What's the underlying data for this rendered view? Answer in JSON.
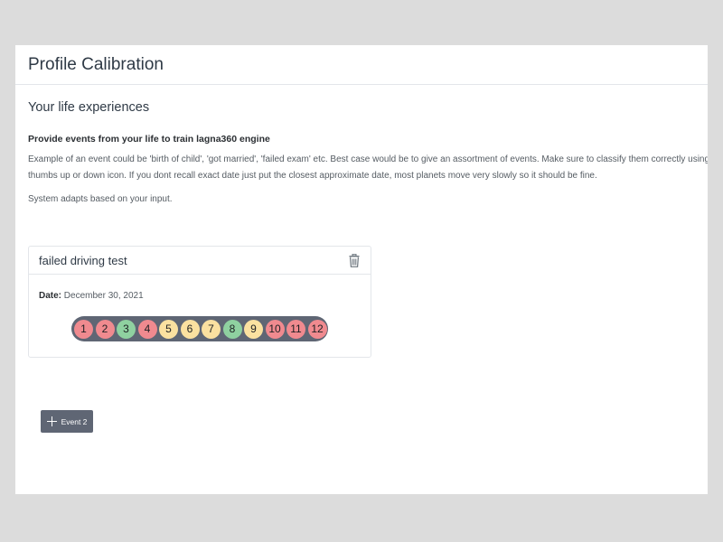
{
  "header": {
    "title": "Profile Calibration"
  },
  "main": {
    "section_title": "Your life experiences",
    "heading": "Provide events from your life to train lagna360 engine",
    "description": "Example of an event could be 'birth of child', 'got married', 'failed exam' etc. Best case would be to give an assortment of events. Make sure to classify them correctly using thumbs up or down icon. If you dont recall exact date just put the closest approximate date, most planets move very slowly so it should be fine.",
    "adapts_text": "System adapts based on your input."
  },
  "event": {
    "name": "failed driving test",
    "date_label": "Date:",
    "date_value": "December 30, 2021",
    "delete_icon": "trash-icon",
    "houses": [
      {
        "label": "1",
        "color": "#f08a8f"
      },
      {
        "label": "2",
        "color": "#f08a8f"
      },
      {
        "label": "3",
        "color": "#8fd1a0"
      },
      {
        "label": "4",
        "color": "#f08a8f"
      },
      {
        "label": "5",
        "color": "#fbe1a0"
      },
      {
        "label": "6",
        "color": "#fbe1a0"
      },
      {
        "label": "7",
        "color": "#fbe1a0"
      },
      {
        "label": "8",
        "color": "#8fd1a0"
      },
      {
        "label": "9",
        "color": "#fbe1a0"
      },
      {
        "label": "10",
        "color": "#f08a8f"
      },
      {
        "label": "11",
        "color": "#f08a8f"
      },
      {
        "label": "12",
        "color": "#f08a8f"
      }
    ]
  },
  "actions": {
    "add_event_label": "Event 2",
    "add_icon": "plus-icon"
  },
  "colors": {
    "background": "#dcdcdc",
    "panel": "#ffffff",
    "button": "#5f6674",
    "positive": "#8fd1a0",
    "negative": "#f08a8f",
    "neutral": "#fbe1a0"
  }
}
